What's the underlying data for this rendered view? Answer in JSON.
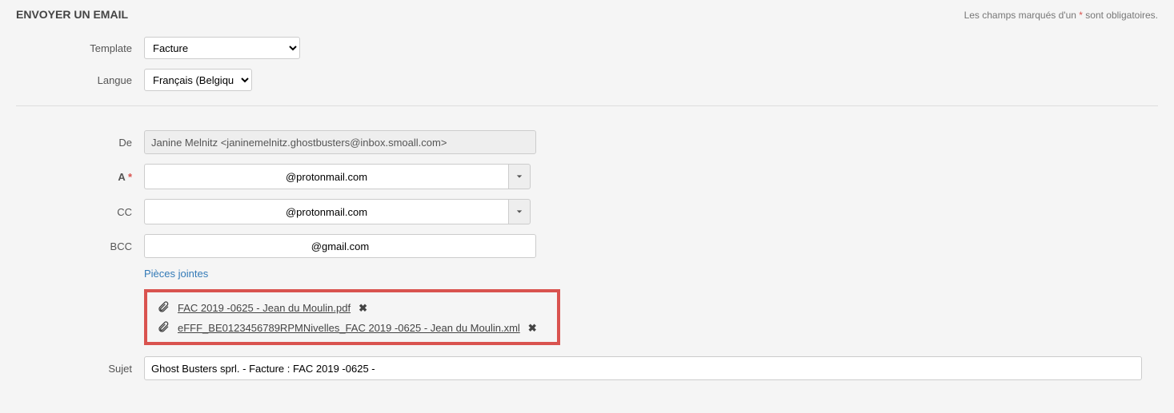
{
  "header": {
    "title": "ENVOYER UN EMAIL",
    "required_note_pre": "Les champs marqués d'un ",
    "required_note_star": "*",
    "required_note_post": " sont obligatoires."
  },
  "labels": {
    "template": "Template",
    "langue": "Langue",
    "de": "De",
    "a": "A",
    "cc": "CC",
    "bcc": "BCC",
    "pieces_jointes": "Pièces jointes",
    "sujet": "Sujet"
  },
  "fields": {
    "template_value": "Facture",
    "langue_value": "Français (Belgique)",
    "de_value": "Janine Melnitz <janinemelnitz.ghostbusters@inbox.smoall.com>",
    "a_value": "@protonmail.com",
    "cc_value": "@protonmail.com",
    "bcc_value": "@gmail.com",
    "sujet_value": "Ghost Busters sprl. - Facture : FAC 2019 -0625 -"
  },
  "attachments": [
    {
      "name": "FAC 2019 -0625 - Jean du Moulin.pdf"
    },
    {
      "name": "eFFF_BE0123456789RPMNivelles_FAC 2019 -0625 - Jean du Moulin.xml"
    }
  ]
}
